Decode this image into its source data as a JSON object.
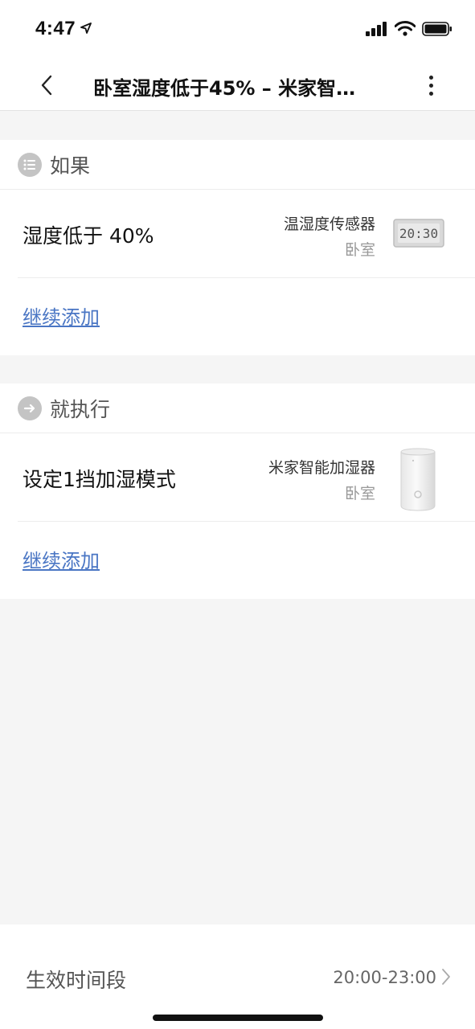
{
  "status_bar": {
    "time": "4:47"
  },
  "nav": {
    "title": "卧室湿度低于45% – 米家智…"
  },
  "if_section": {
    "title": "如果",
    "condition": {
      "label": "湿度低于 40%",
      "device": "温湿度传感器",
      "room": "卧室",
      "display_time": "20:30"
    },
    "add_label": "继续添加"
  },
  "then_section": {
    "title": "就执行",
    "action": {
      "label": "设定1挡加湿模式",
      "device": "米家智能加湿器",
      "room": "卧室"
    },
    "add_label": "继续添加"
  },
  "footer": {
    "label": "生效时间段",
    "value": "20:00-23:00"
  }
}
